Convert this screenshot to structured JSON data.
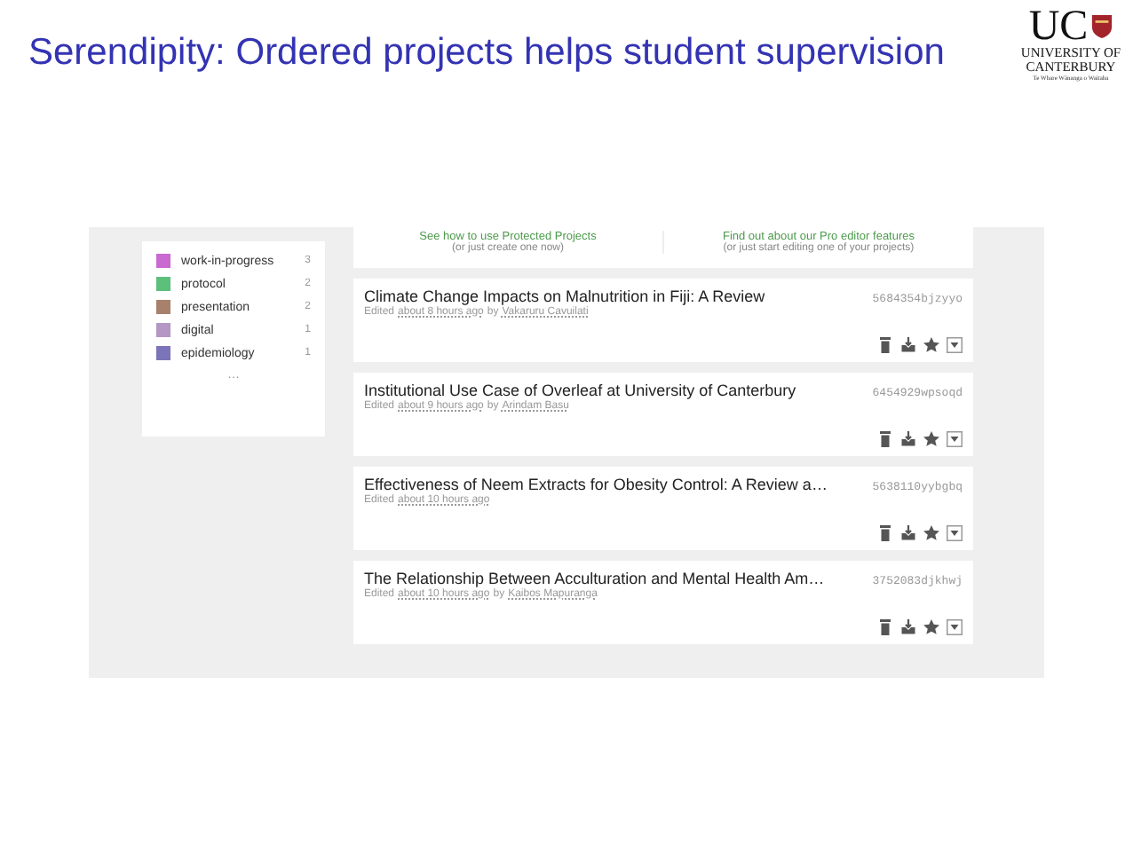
{
  "slide_title": "Serendipity: Ordered projects helps student supervision",
  "logo": {
    "mark": "UC",
    "name_line_1": "UNIVERSITY OF",
    "name_line_2": "CANTERBURY",
    "motto": "Te Whare Wānanga o Waitaha"
  },
  "tags": [
    {
      "name": "work-in-progress",
      "count": "3",
      "color": "#c86ad0"
    },
    {
      "name": "protocol",
      "count": "2",
      "color": "#5cbf7a"
    },
    {
      "name": "presentation",
      "count": "2",
      "color": "#a8816c"
    },
    {
      "name": "digital",
      "count": "1",
      "color": "#b497c4"
    },
    {
      "name": "epidemiology",
      "count": "1",
      "color": "#7b74b8"
    }
  ],
  "tags_more": "…",
  "promos": [
    {
      "link": "See how to use Protected Projects",
      "sub": "(or just create one now)"
    },
    {
      "link": "Find out about our Pro editor features",
      "sub": "(or just start editing one of your projects)"
    }
  ],
  "projects": [
    {
      "title": "Climate Change Impacts on Malnutrition in Fiji: A Review",
      "id": "5684354bjzyyo",
      "edited": "Edited",
      "time": "about 8 hours ago",
      "by": "by",
      "author": "Vakaruru Cavuilati"
    },
    {
      "title": "Institutional Use Case of Overleaf at University of Canterbury",
      "id": "6454929wpsoqd",
      "edited": "Edited",
      "time": "about 9 hours ago",
      "by": "by",
      "author": "Arindam Basu"
    },
    {
      "title": "Effectiveness of Neem Extracts for Obesity Control: A Review a…",
      "id": "5638110yybgbq",
      "edited": "Edited",
      "time": "about 10 hours ago"
    },
    {
      "title": "The Relationship Between Acculturation and Mental Health Am…",
      "id": "3752083djkhwj",
      "edited": "Edited",
      "time": "about 10 hours ago",
      "by": "by",
      "author": "Kaibos Mapuranga"
    }
  ]
}
